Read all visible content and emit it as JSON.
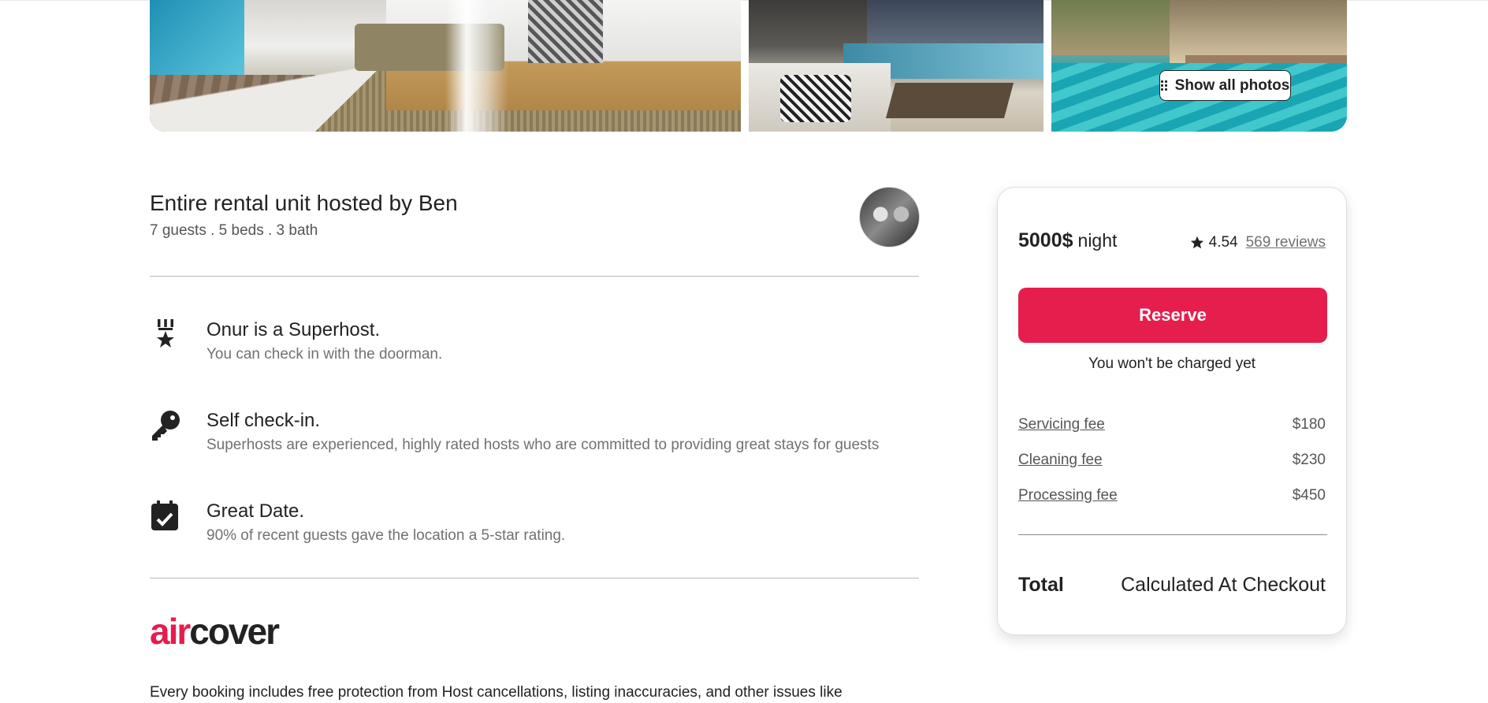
{
  "gallery": {
    "show_all_label": "Show all photos"
  },
  "listing": {
    "title": "Entire rental unit hosted by Ben",
    "subtitle": "7 guests . 5 beds . 3 bath"
  },
  "features": [
    {
      "icon": "superhost-badge-icon",
      "title": "Onur is a Superhost.",
      "description": "You can check in with the doorman."
    },
    {
      "icon": "key-icon",
      "title": "Self check-in.",
      "description": "Superhosts are experienced, highly rated hosts who are committed to providing great stays for guests"
    },
    {
      "icon": "calendar-check-icon",
      "title": "Great Date.",
      "description": "90% of recent guests gave the location a 5-star rating."
    }
  ],
  "aircover": {
    "logo_air": "air",
    "logo_cover": "cover",
    "text": "Every booking includes free protection from Host cancellations, listing inaccuracies, and other issues like"
  },
  "booking": {
    "price": "5000$",
    "per": "night",
    "rating": "4.54",
    "reviews": "569 reviews",
    "reserve_label": "Reserve",
    "no_charge": "You won't be charged yet",
    "fees": [
      {
        "label": "Servicing fee",
        "amount": "$180"
      },
      {
        "label": "Cleaning fee",
        "amount": "$230"
      },
      {
        "label": "Processing fee",
        "amount": "$450"
      }
    ],
    "total_label": "Total",
    "total_value": "Calculated At Checkout"
  },
  "colors": {
    "brand": "#e61e4d",
    "text": "#222222",
    "muted": "#717171"
  }
}
